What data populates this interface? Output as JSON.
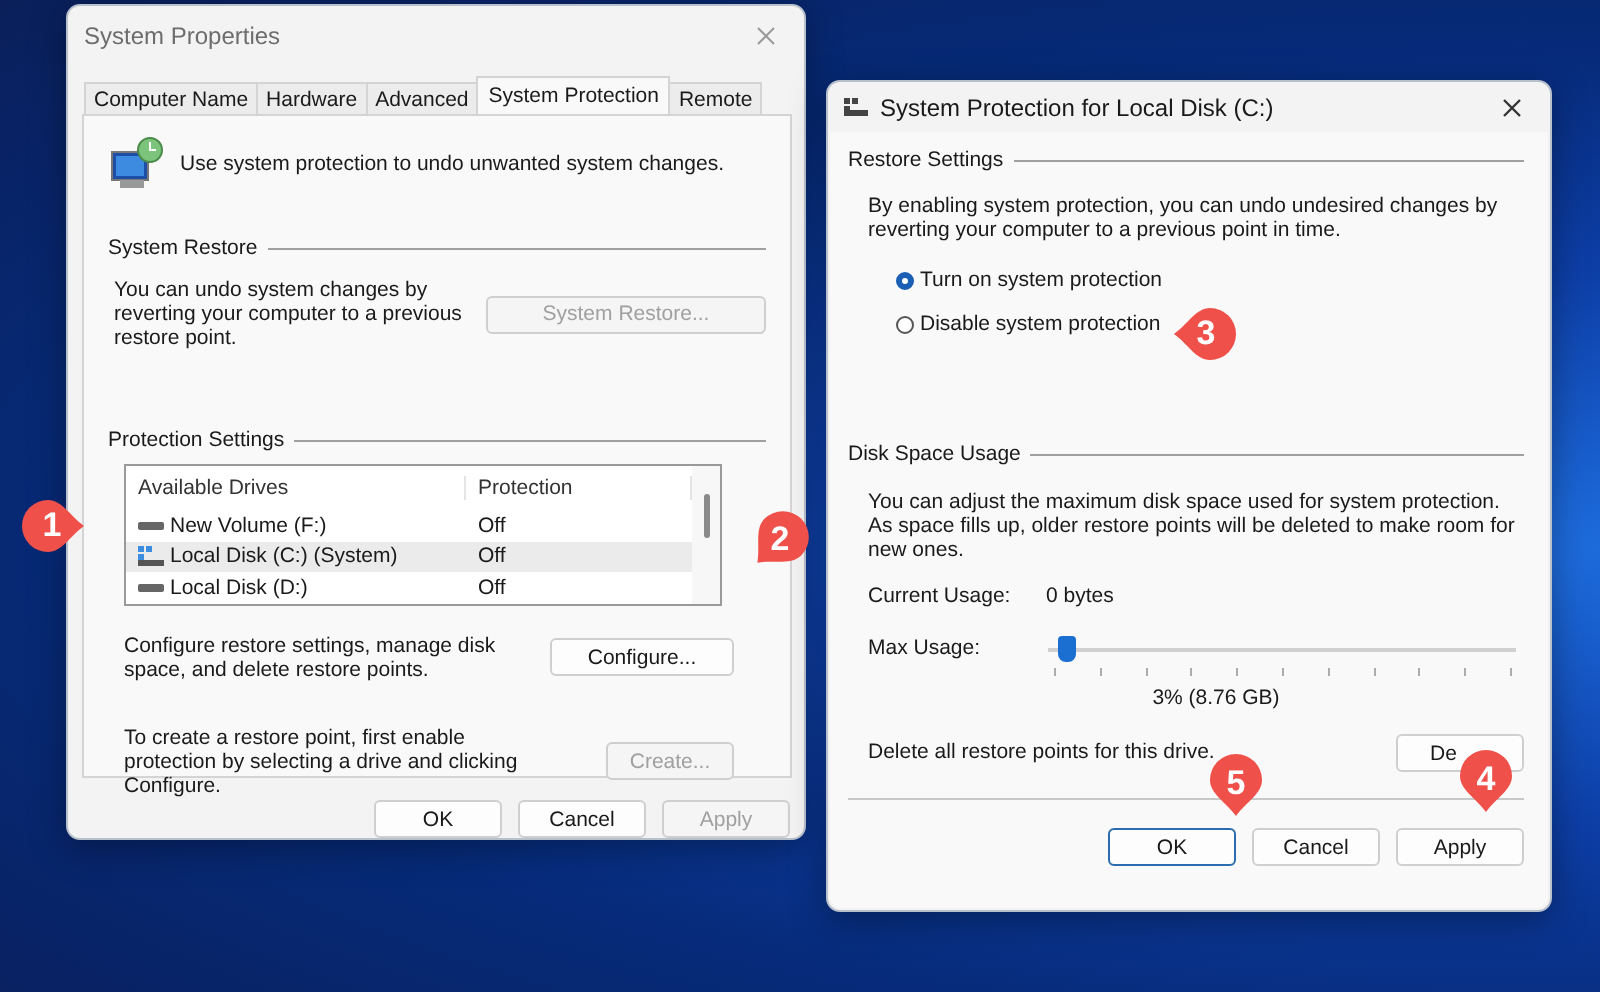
{
  "system_properties": {
    "title": "System Properties",
    "tabs": [
      {
        "label": "Computer Name",
        "selected": false
      },
      {
        "label": "Hardware",
        "selected": false
      },
      {
        "label": "Advanced",
        "selected": false
      },
      {
        "label": "System Protection",
        "selected": true
      },
      {
        "label": "Remote",
        "selected": false
      }
    ],
    "intro": "Use system protection to undo unwanted system changes.",
    "system_restore": {
      "heading": "System Restore",
      "text": "You can undo system changes by reverting your computer to a previous restore point.",
      "button": {
        "label": "System Restore...",
        "disabled": true
      }
    },
    "protection_settings": {
      "heading": "Protection Settings",
      "columns": [
        "Available Drives",
        "Protection"
      ],
      "rows": [
        {
          "kind": "volume",
          "drive": "New Volume (F:)",
          "protection": "Off",
          "selected": false
        },
        {
          "kind": "system",
          "drive": "Local Disk (C:) (System)",
          "protection": "Off",
          "selected": true
        },
        {
          "kind": "volume",
          "drive": "Local Disk (D:)",
          "protection": "Off",
          "selected": false
        }
      ]
    },
    "actions": [
      {
        "text": "Configure restore settings, manage disk space, and delete restore points.",
        "button": {
          "label": "Configure...",
          "disabled": false
        }
      },
      {
        "text": "To create a restore point, first enable protection by selecting a drive and clicking Configure.",
        "button": {
          "label": "Create...",
          "disabled": true
        }
      }
    ],
    "buttons": [
      {
        "label": "OK",
        "disabled": false
      },
      {
        "label": "Cancel",
        "disabled": false
      },
      {
        "label": "Apply",
        "disabled": true
      }
    ]
  },
  "protection_dialog": {
    "title": "System Protection for Local Disk (C:)",
    "restore_settings": {
      "heading": "Restore Settings",
      "text": "By enabling system protection, you can undo undesired changes by reverting your computer to a previous point in time.",
      "options": [
        {
          "label": "Turn on system protection",
          "selected": true
        },
        {
          "label": "Disable system protection",
          "selected": false
        }
      ]
    },
    "disk_space_usage": {
      "heading": "Disk Space Usage",
      "text": "You can adjust the maximum disk space used for system protection. As space fills up, older restore points will be deleted to make room for new ones.",
      "current_usage_label": "Current Usage:",
      "current_usage": "0 bytes",
      "max_usage_label": "Max Usage:",
      "slider": {
        "level": 0.03
      },
      "reading": "3% (8.76 GB)",
      "delete_text": "Delete all restore points for this drive.",
      "delete_button": "De"
    },
    "buttons": [
      {
        "label": "OK",
        "focused": true
      },
      {
        "label": "Cancel",
        "focused": false
      },
      {
        "label": "Apply",
        "focused": false
      }
    ]
  },
  "callouts": [
    {
      "label": "1"
    },
    {
      "label": "2"
    },
    {
      "label": "3"
    },
    {
      "label": "4"
    },
    {
      "label": "5"
    }
  ]
}
